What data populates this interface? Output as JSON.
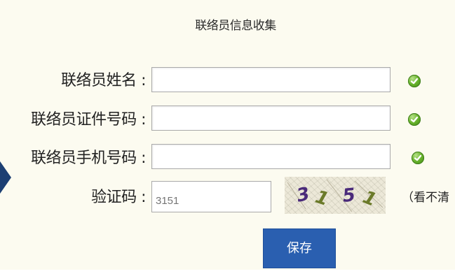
{
  "form": {
    "title": "联络员信息收集",
    "fields": [
      {
        "label": "联络员姓名 :",
        "value": "",
        "status": "valid"
      },
      {
        "label": "联络员证件号码 :",
        "value": "",
        "status": "valid"
      },
      {
        "label": "联络员手机号码 :",
        "value": "",
        "status": "valid"
      }
    ],
    "captcha": {
      "label": "验证码 :",
      "placeholder": "3151",
      "image_text": "3151",
      "hint": "（看不清"
    },
    "save_label": "保存"
  },
  "colors": {
    "background": "#fcfbf0",
    "button": "#2a5fb0",
    "valid_icon": "#5aa52a",
    "arrow": "#1c3f73"
  },
  "icons": {
    "field_status": "check-circle-icon",
    "left": "arrow-left-icon"
  }
}
